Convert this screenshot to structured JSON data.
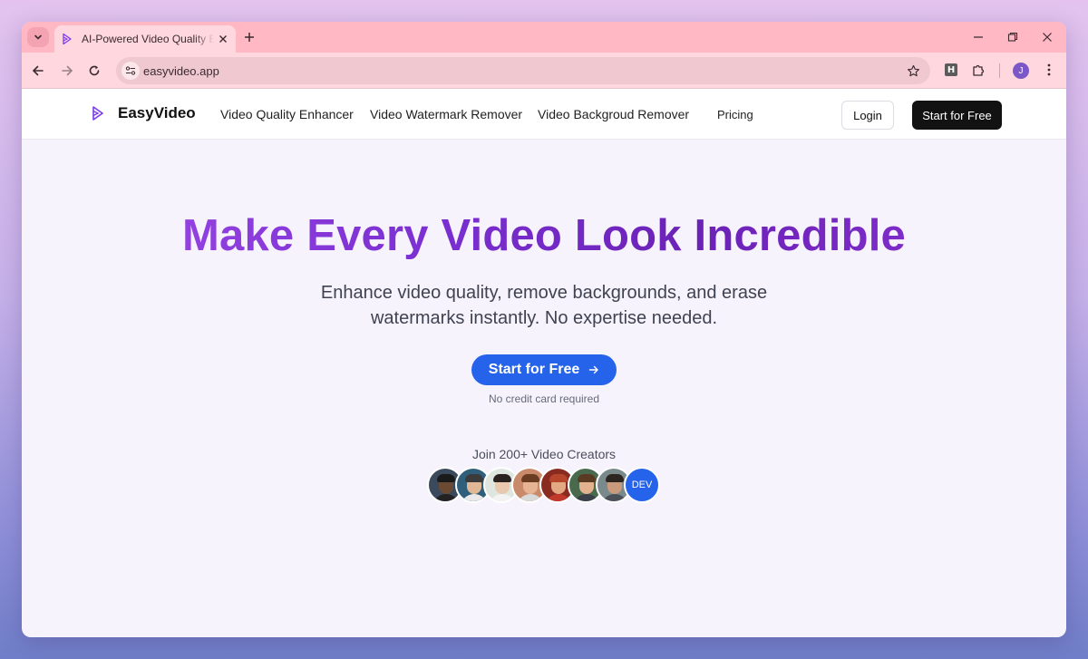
{
  "browser": {
    "tab_title": "AI-Powered Video Quality Enhancer",
    "url": "easyvideo.app",
    "profile_initial": "J",
    "extension_label": "H"
  },
  "header": {
    "brand": "EasyVideo",
    "nav": [
      {
        "label": "Video Quality Enhancer"
      },
      {
        "label": "Video Watermark Remover"
      },
      {
        "label": "Video Backgroud Remover"
      },
      {
        "label": "Pricing"
      }
    ],
    "login_label": "Login",
    "start_label": "Start for Free"
  },
  "hero": {
    "title": "Make Every Video Look Incredible",
    "subtitle": "Enhance video quality, remove backgrounds, and erase watermarks instantly. No expertise needed.",
    "cta_label": "Start for Free",
    "cta_note": "No credit card required",
    "join_text": "Join 200+ Video Creators",
    "dev_avatar_label": "DEV"
  },
  "colors": {
    "accent_blue": "#2563eb",
    "title_purple": "#7a2fd0",
    "tab_strip": "#ffb8c4"
  }
}
